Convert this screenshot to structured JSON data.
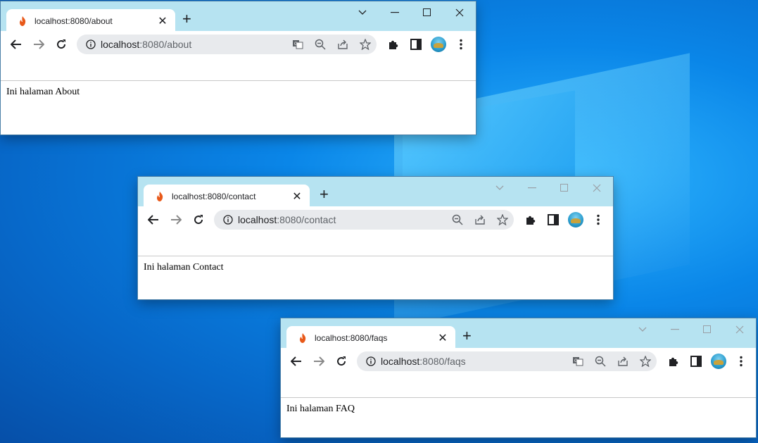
{
  "windows": [
    {
      "id": "about",
      "tab_title": "localhost:8080/about",
      "url_host": "localhost",
      "url_path": ":8080/about",
      "page_text": "Ini halaman About",
      "has_translate_icon": true
    },
    {
      "id": "contact",
      "tab_title": "localhost:8080/contact",
      "url_host": "localhost",
      "url_path": ":8080/contact",
      "page_text": "Ini halaman Contact",
      "has_translate_icon": false
    },
    {
      "id": "faqs",
      "tab_title": "localhost:8080/faqs",
      "url_host": "localhost",
      "url_path": ":8080/faqs",
      "page_text": "Ini halaman FAQ",
      "has_translate_icon": true
    }
  ],
  "icons": {
    "favicon": "flame-icon",
    "back": "back-arrow-icon",
    "forward": "forward-arrow-icon",
    "reload": "reload-icon",
    "site_info": "info-icon",
    "translate": "translate-icon",
    "zoom": "zoom-out-icon",
    "share": "share-icon",
    "bookmark": "star-icon",
    "extensions": "puzzle-icon",
    "side_panel": "side-panel-icon",
    "menu": "kebab-menu-icon"
  },
  "colors": {
    "titlebar": "#b6e3f1",
    "favicon": "#e8591a",
    "desktop": "#0a86e8"
  }
}
